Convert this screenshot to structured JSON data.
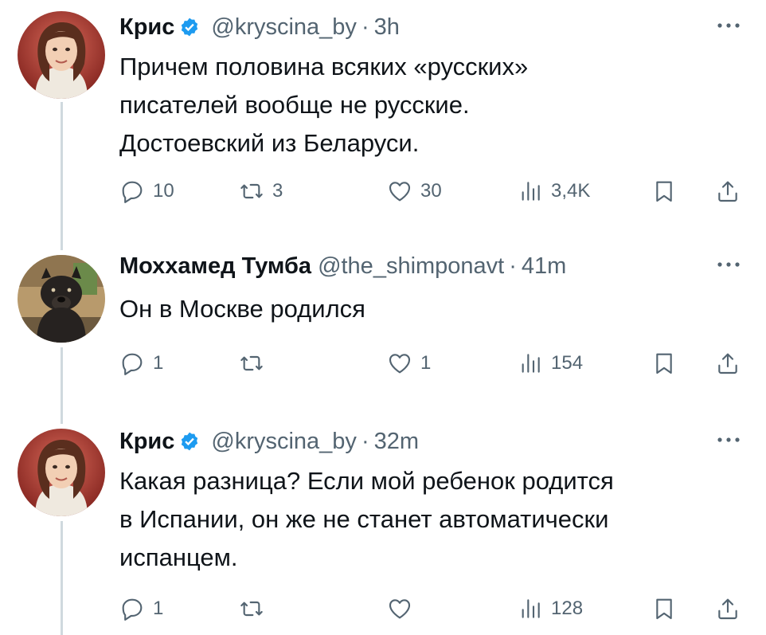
{
  "tweets": [
    {
      "name": "Крис",
      "handle": "@kryscina_by",
      "sep": "·",
      "time": "3h",
      "lines": [
        "Причем половина всяких «русских»",
        "писателей вообще не русские.",
        "Достоевский из Беларуси."
      ],
      "replies": "10",
      "retweets": "3",
      "likes": "30",
      "views": "3,4K",
      "avatar_icon": "woman-avatar-icon"
    },
    {
      "name": "Моххамед Тумба",
      "handle": "@the_shimponavt",
      "sep": "·",
      "time": "41m",
      "lines": [
        "Он в Москве родился"
      ],
      "replies": "1",
      "retweets": "",
      "likes": "1",
      "views": "154",
      "avatar_icon": "black-dog-avatar-icon"
    },
    {
      "name": "Крис",
      "handle": "@kryscina_by",
      "sep": "·",
      "time": "32m",
      "lines": [
        "Какая разница? Если мой ребенок родится",
        "в Испании, он же не станет автоматически",
        "испанцем."
      ],
      "replies": "1",
      "retweets": "",
      "likes": "",
      "views": "128",
      "avatar_icon": "woman-avatar-icon"
    }
  ],
  "colors": {
    "verified": "#1d9bf0",
    "muted": "#536471",
    "text": "#0f1419",
    "thread_line": "#cfd9de"
  },
  "icons": [
    "reply-icon",
    "retweet-icon",
    "like-icon",
    "views-icon",
    "bookmark-icon",
    "share-icon",
    "more-icon",
    "verified-badge-icon"
  ]
}
